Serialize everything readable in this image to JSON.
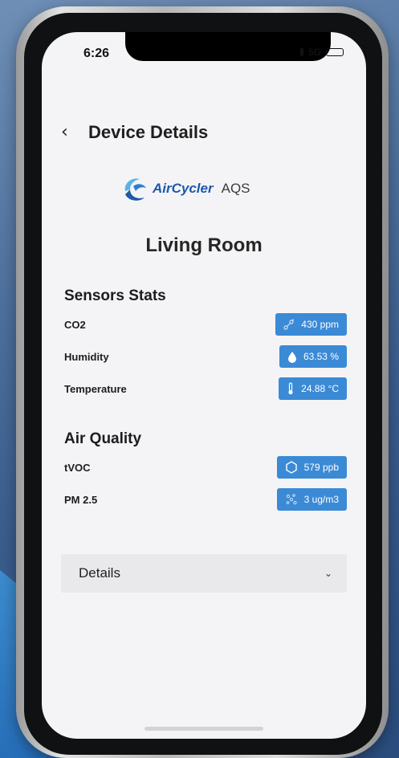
{
  "status_bar": {
    "time": "6:26",
    "network": "5G"
  },
  "header": {
    "back_icon": "chevron-left-icon",
    "title": "Device Details"
  },
  "brand": {
    "name": "AirCycler",
    "suffix": "AQS"
  },
  "room": {
    "name": "Living Room"
  },
  "sensors": {
    "title": "Sensors Stats",
    "rows": [
      {
        "label": "CO2",
        "value": "430 ppm",
        "icon": "molecule-icon"
      },
      {
        "label": "Humidity",
        "value": "63.53 %",
        "icon": "water-drop-icon"
      },
      {
        "label": "Temperature",
        "value": "24.88 °C",
        "icon": "thermometer-icon"
      }
    ]
  },
  "air_quality": {
    "title": "Air Quality",
    "rows": [
      {
        "label": "tVOC",
        "value": "579 ppb",
        "icon": "hexagon-icon"
      },
      {
        "label": "PM 2.5",
        "value": "3 ug/m3",
        "icon": "particles-icon"
      }
    ]
  },
  "details": {
    "label": "Details",
    "icon": "chevron-down-icon"
  },
  "colors": {
    "accent": "#3b8ad6",
    "brand": "#1d5aa8"
  }
}
